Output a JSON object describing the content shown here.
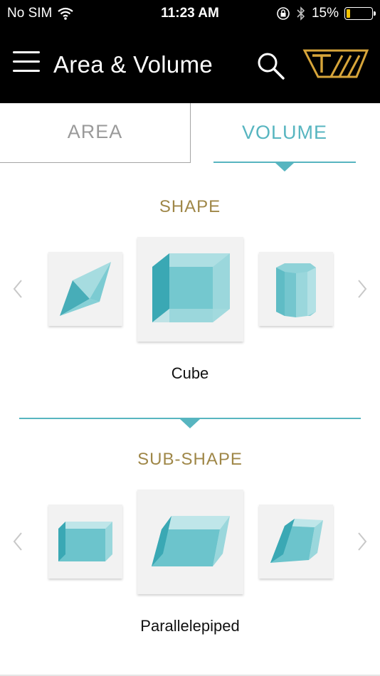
{
  "status": {
    "carrier": "No SIM",
    "time": "11:23 AM",
    "battery": "15%",
    "battery_level": 0.15,
    "battery_color": "#f5c400"
  },
  "app_bar": {
    "title": "Area & Volume",
    "menu_icon": "hamburger-menu-icon",
    "search_icon": "search-icon",
    "logo_icon": "brand-logo",
    "logo_letter": "T"
  },
  "tabs": [
    {
      "label": "AREA",
      "active": false
    },
    {
      "label": "VOLUME",
      "active": true
    }
  ],
  "shape_section": {
    "title": "SHAPE",
    "selected_label": "Cube",
    "items": [
      {
        "icon": "octahedron-icon"
      },
      {
        "icon": "cube-icon",
        "selected": true
      },
      {
        "icon": "prism-icon"
      }
    ]
  },
  "subshape_section": {
    "title": "SUB-SHAPE",
    "selected_label": "Parallelepiped",
    "items": [
      {
        "icon": "cuboid-icon"
      },
      {
        "icon": "parallelepiped-icon",
        "selected": true
      },
      {
        "icon": "rhombohedron-icon"
      }
    ]
  },
  "colors": {
    "accent": "#57b5c0",
    "gold": "#9f8748",
    "logo_gold": "#d7a53a",
    "shape_face": "#5fc0c8"
  }
}
